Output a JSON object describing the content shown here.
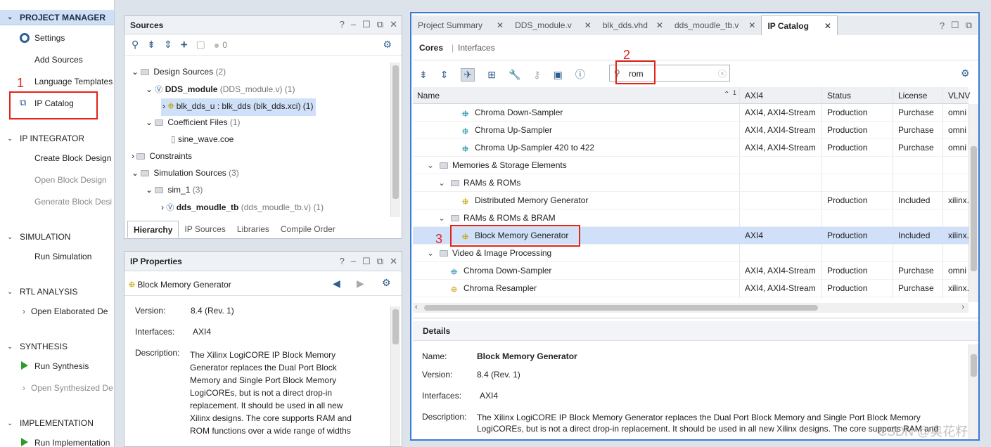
{
  "flow_nav": {
    "project_manager": "PROJECT MANAGER",
    "settings": "Settings",
    "add_sources": "Add Sources",
    "language_templates": "Language Templates",
    "ip_catalog": "IP Catalog",
    "ip_integrator": "IP INTEGRATOR",
    "create_block_design": "Create Block Design",
    "open_block_design": "Open Block Design",
    "generate_block_design": "Generate Block Desi",
    "simulation": "SIMULATION",
    "run_simulation": "Run Simulation",
    "rtl_analysis": "RTL ANALYSIS",
    "open_elaborated": "Open Elaborated De",
    "synthesis": "SYNTHESIS",
    "run_synthesis": "Run Synthesis",
    "open_synthesized": "Open Synthesized De",
    "implementation": "IMPLEMENTATION",
    "run_implementation": "Run Implementation"
  },
  "annotations": {
    "n1": "1",
    "n2": "2",
    "n3": "3"
  },
  "sources": {
    "title": "Sources",
    "badge": "0",
    "design_sources": "Design Sources",
    "design_sources_count": "(2)",
    "dds_module": "DDS_module",
    "dds_module_detail": "(DDS_module.v) (1)",
    "blk_dds": "blk_dds_u : blk_dds (blk_dds.xci) (1)",
    "coefficient_files": "Coefficient Files",
    "coefficient_count": "(1)",
    "sine_wave": "sine_wave.coe",
    "constraints": "Constraints",
    "simulation_sources": "Simulation Sources",
    "simulation_count": "(3)",
    "sim_1": "sim_1",
    "sim_1_count": "(3)",
    "dds_moudle_tb": "dds_moudle_tb",
    "dds_moudle_tb_detail": "(dds_moudle_tb.v) (1)",
    "tabs": [
      "Hierarchy",
      "IP Sources",
      "Libraries",
      "Compile Order"
    ]
  },
  "ip_properties": {
    "title": "IP Properties",
    "name": "Block Memory Generator",
    "version_label": "Version:",
    "version": "8.4 (Rev. 1)",
    "interfaces_label": "Interfaces:",
    "interfaces": "AXI4",
    "description_label": "Description:",
    "description_lines": [
      "The Xilinx LogiCORE IP Block Memory",
      "Generator replaces the Dual Port Block",
      "Memory and Single Port Block Memory",
      "LogiCOREs, but is not a direct drop-in",
      "replacement. It should be used in all new",
      "Xilinx designs. The core supports RAM and",
      "ROM functions over a wide range of widths"
    ]
  },
  "editor_tabs": [
    "Project Summary",
    "DDS_module.v",
    "blk_dds.vhd",
    "dds_moudle_tb.v",
    "IP Catalog"
  ],
  "catalog": {
    "subtabs": [
      "Cores",
      "Interfaces"
    ],
    "search_value": "rom",
    "columns": [
      "Name",
      "AXI4",
      "Status",
      "License",
      "VLNV"
    ],
    "sort_indicator": "1",
    "rows": [
      {
        "name": "Chroma Down-Sampler",
        "axi": "AXI4, AXI4-Stream",
        "status": "Production",
        "license": "Purchase",
        "vlnv": "omni"
      },
      {
        "name": "Chroma Up-Sampler",
        "axi": "AXI4, AXI4-Stream",
        "status": "Production",
        "license": "Purchase",
        "vlnv": "omni"
      },
      {
        "name": "Chroma Up-Sampler 420 to 422",
        "axi": "AXI4, AXI4-Stream",
        "status": "Production",
        "license": "Purchase",
        "vlnv": "omni"
      },
      {
        "name": "Memories & Storage Elements",
        "axi": "",
        "status": "",
        "license": "",
        "vlnv": ""
      },
      {
        "name": "RAMs & ROMs",
        "axi": "",
        "status": "",
        "license": "",
        "vlnv": ""
      },
      {
        "name": "Distributed Memory Generator",
        "axi": "",
        "status": "Production",
        "license": "Included",
        "vlnv": "xilinx."
      },
      {
        "name": "RAMs & ROMs & BRAM",
        "axi": "",
        "status": "",
        "license": "",
        "vlnv": ""
      },
      {
        "name": "Block Memory Generator",
        "axi": "AXI4",
        "status": "Production",
        "license": "Included",
        "vlnv": "xilinx."
      },
      {
        "name": "Video & Image Processing",
        "axi": "",
        "status": "",
        "license": "",
        "vlnv": ""
      },
      {
        "name": "Chroma Down-Sampler",
        "axi": "AXI4, AXI4-Stream",
        "status": "Production",
        "license": "Purchase",
        "vlnv": "omni"
      },
      {
        "name": "Chroma Resampler",
        "axi": "AXI4, AXI4-Stream",
        "status": "Production",
        "license": "Purchase",
        "vlnv": "xilinx."
      }
    ]
  },
  "details": {
    "title": "Details",
    "name_label": "Name:",
    "name": "Block Memory Generator",
    "version_label": "Version:",
    "version": "8.4 (Rev. 1)",
    "interfaces_label": "Interfaces:",
    "interfaces": "AXI4",
    "description_label": "Description:",
    "description_lines": [
      "The Xilinx LogiCORE IP Block Memory Generator replaces the Dual Port Block Memory and Single Port Block Memory",
      "LogiCOREs, but is not a direct drop-in replacement.  It should be used in all new Xilinx designs. The core supports RAM and"
    ],
    "watermark": "CSDN @奥花籽"
  }
}
